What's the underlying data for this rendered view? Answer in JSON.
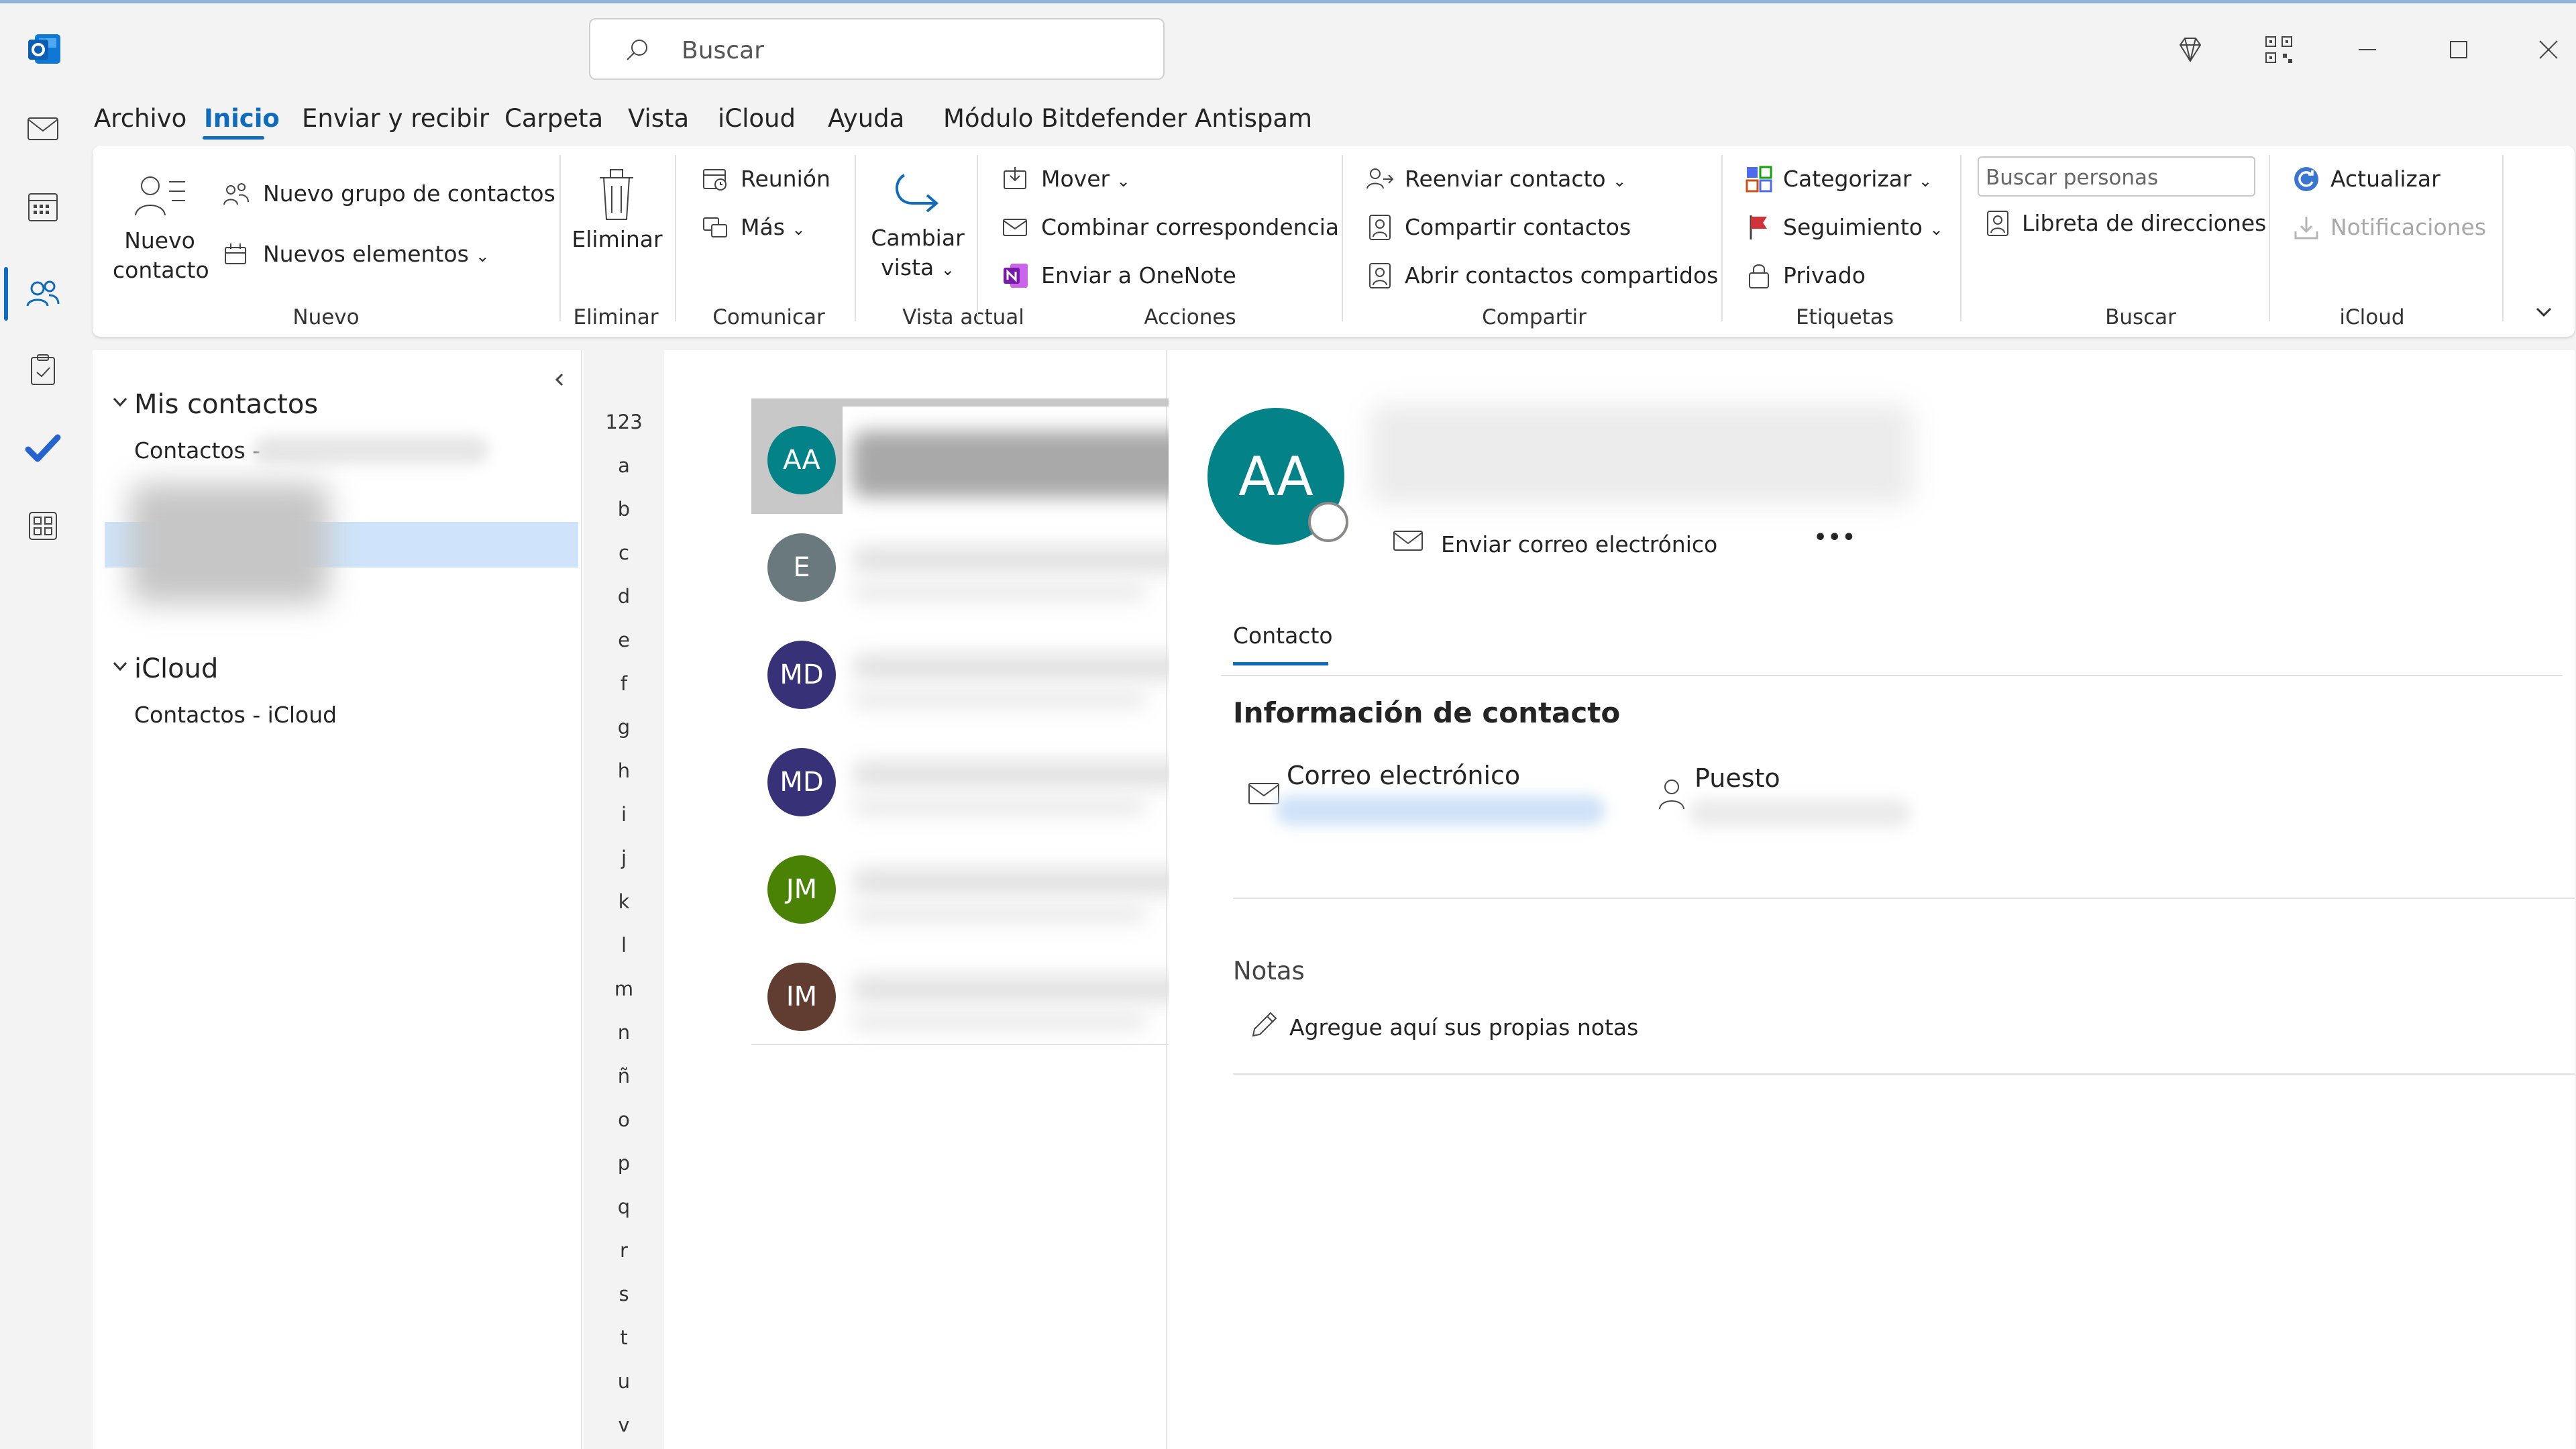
{
  "window": {
    "search_placeholder": "Buscar"
  },
  "menu": [
    "Archivo",
    "Inicio",
    "Enviar y recibir",
    "Carpeta",
    "Vista",
    "iCloud",
    "Ayuda",
    "Módulo Bitdefender Antispam"
  ],
  "ribbon": {
    "nuevo": {
      "nuevo_contacto_1": "Nuevo",
      "nuevo_contacto_2": "contacto",
      "nuevo_grupo": "Nuevo grupo de contactos",
      "nuevos_elementos": "Nuevos elementos",
      "group": "Nuevo"
    },
    "eliminar": {
      "label": "Eliminar",
      "group": "Eliminar"
    },
    "comunicar": {
      "reunion": "Reunión",
      "mas": "Más",
      "group": "Comunicar"
    },
    "vista_actual": {
      "label_1": "Cambiar",
      "label_2": "vista",
      "group": "Vista actual"
    },
    "acciones": {
      "mover": "Mover",
      "combinar": "Combinar correspondencia",
      "onenote": "Enviar a OneNote",
      "group": "Acciones"
    },
    "compartir": {
      "reenviar": "Reenviar contacto",
      "compartir": "Compartir contactos",
      "abrir": "Abrir contactos compartidos",
      "group": "Compartir"
    },
    "etiquetas": {
      "categorizar": "Categorizar",
      "seguimiento": "Seguimiento",
      "privado": "Privado",
      "group": "Etiquetas"
    },
    "buscar": {
      "placeholder": "Buscar personas",
      "libreta": "Libreta de direcciones",
      "group": "Buscar"
    },
    "icloud": {
      "actualizar": "Actualizar",
      "notificaciones": "Notificaciones",
      "group": "iCloud"
    }
  },
  "folders": {
    "mis_contactos": "Mis contactos",
    "contactos": "Contactos -",
    "icloud": "iCloud",
    "contactos_icloud": "Contactos - iCloud"
  },
  "alphabet": [
    "123",
    "a",
    "b",
    "c",
    "d",
    "e",
    "f",
    "g",
    "h",
    "i",
    "j",
    "k",
    "l",
    "m",
    "n",
    "ñ",
    "o",
    "p",
    "q",
    "r",
    "s",
    "t",
    "u",
    "v"
  ],
  "contacts": [
    {
      "initials": "AA",
      "color": "#038387"
    },
    {
      "initials": "E",
      "color": "#69797e"
    },
    {
      "initials": "MD",
      "color": "#373277"
    },
    {
      "initials": "MD",
      "color": "#373277"
    },
    {
      "initials": "JM",
      "color": "#498205"
    },
    {
      "initials": "IM",
      "color": "#603d30"
    }
  ],
  "card": {
    "initials": "AA",
    "avatar_color": "#038387",
    "send_email": "Enviar correo electrónico",
    "more": "•••",
    "tab": "Contacto",
    "section_title": "Información de contacto",
    "email_label": "Correo electrónico",
    "job_label": "Puesto",
    "notes_label": "Notas",
    "notes_placeholder": "Agregue aquí sus propias notas"
  }
}
